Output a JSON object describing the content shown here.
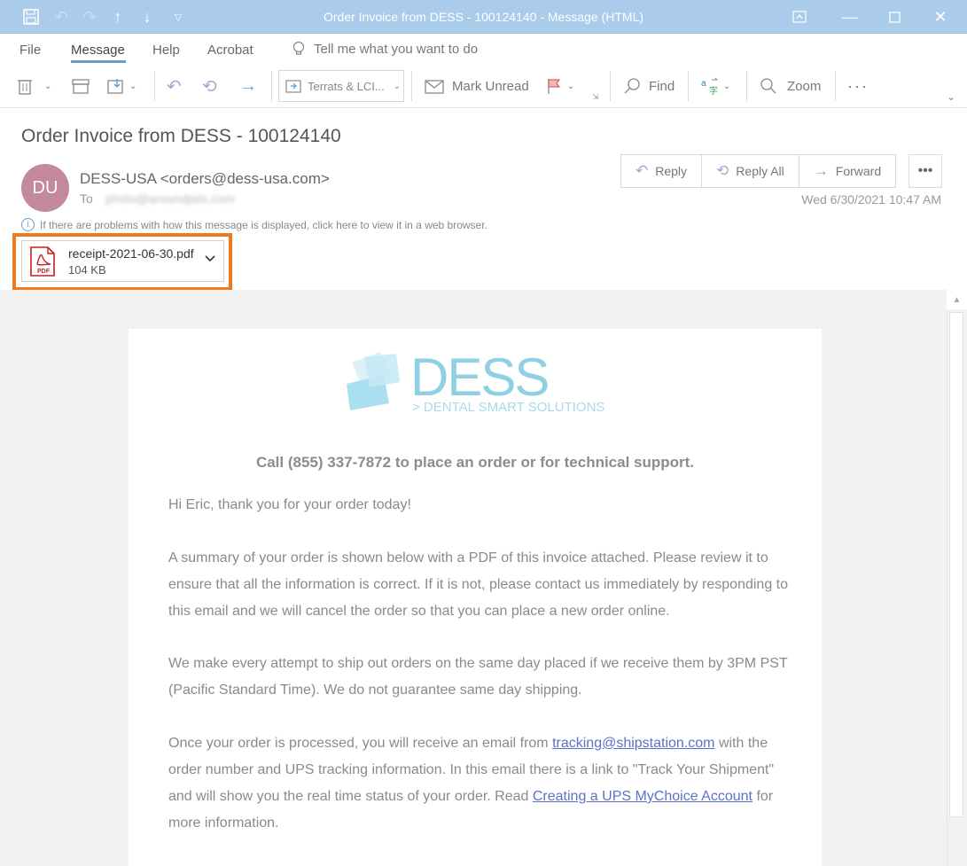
{
  "window": {
    "title": "Order Invoice from DESS - 100124140  -  Message (HTML)"
  },
  "menu": {
    "items": [
      "File",
      "Message",
      "Help",
      "Acrobat"
    ],
    "tell_me": "Tell me what you want to do"
  },
  "ribbon": {
    "quick_steps": "Terrats & LCI...",
    "mark_unread": "Mark Unread",
    "find": "Find",
    "zoom": "Zoom"
  },
  "message": {
    "subject": "Order Invoice from DESS - 100124140",
    "avatar_initials": "DU",
    "avatar_color": "#c4899b",
    "sender": "DESS-USA <orders@dess-usa.com>",
    "to_label": "To",
    "to_value": "photo@aroundpdx.com",
    "date": "Wed 6/30/2021 10:47 AM",
    "info_bar": "If there are problems with how this message is displayed, click here to view it in a web browser.",
    "actions": {
      "reply": "Reply",
      "reply_all": "Reply All",
      "forward": "Forward"
    }
  },
  "attachment": {
    "filename": "receipt-2021-06-30.pdf",
    "size": "104 KB",
    "icon_label": "PDF",
    "highlight_color": "#f07a1a"
  },
  "email_body": {
    "logo_name": "DESS",
    "logo_tagline": "> DENTAL SMART SOLUTIONS",
    "callout": "Call (855) 337-7872 to place an order or for technical support.",
    "greeting": "Hi Eric, thank you for your order today!",
    "p1": "A summary of your order is shown below with a PDF of this invoice attached. Please review it to ensure that all the information is correct. If it is not, please contact us immediately by responding to this email and we will cancel the order so that you can place a new order online.",
    "p2": "We make every attempt to ship out orders on the same day placed if we receive them by 3PM PST (Pacific Standard Time). We do not guarantee same day shipping.",
    "p3_a": "Once your order is processed, you will receive an email from ",
    "p3_link1": "tracking@shipstation.com",
    "p3_b": " with the order number and UPS tracking information. In this email there is a link to \"Track Your Shipment\" and will show you the real time status of your order. Read ",
    "p3_link2": "Creating a UPS MyChoice Account",
    "p3_c": " for more information."
  }
}
